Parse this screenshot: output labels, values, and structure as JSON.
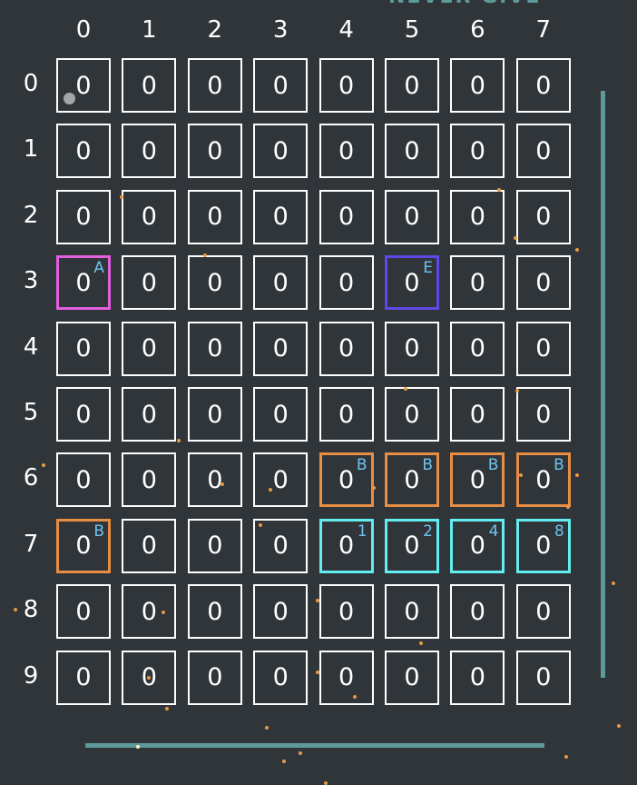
{
  "game": {
    "title": "NEVER GIVE",
    "column_labels": [
      "0",
      "1",
      "2",
      "3",
      "4",
      "5",
      "6",
      "7"
    ],
    "row_labels": [
      "0",
      "1",
      "2",
      "3",
      "4",
      "5",
      "6",
      "7",
      "8",
      "9"
    ],
    "rows": [
      [
        {
          "v": "0"
        },
        {
          "v": "0"
        },
        {
          "v": "0"
        },
        {
          "v": "0"
        },
        {
          "v": "0"
        },
        {
          "v": "0"
        },
        {
          "v": "0"
        },
        {
          "v": "0"
        }
      ],
      [
        {
          "v": "0"
        },
        {
          "v": "0"
        },
        {
          "v": "0"
        },
        {
          "v": "0"
        },
        {
          "v": "0"
        },
        {
          "v": "0"
        },
        {
          "v": "0"
        },
        {
          "v": "0"
        }
      ],
      [
        {
          "v": "0"
        },
        {
          "v": "0"
        },
        {
          "v": "0"
        },
        {
          "v": "0"
        },
        {
          "v": "0"
        },
        {
          "v": "0"
        },
        {
          "v": "0"
        },
        {
          "v": "0"
        }
      ],
      [
        {
          "v": "0",
          "tag": "A",
          "color": "#e45ee0"
        },
        {
          "v": "0"
        },
        {
          "v": "0"
        },
        {
          "v": "0"
        },
        {
          "v": "0"
        },
        {
          "v": "0",
          "tag": "E",
          "color": "#5f48e8"
        },
        {
          "v": "0"
        },
        {
          "v": "0"
        }
      ],
      [
        {
          "v": "0"
        },
        {
          "v": "0"
        },
        {
          "v": "0"
        },
        {
          "v": "0"
        },
        {
          "v": "0"
        },
        {
          "v": "0"
        },
        {
          "v": "0"
        },
        {
          "v": "0"
        }
      ],
      [
        {
          "v": "0"
        },
        {
          "v": "0"
        },
        {
          "v": "0"
        },
        {
          "v": "0"
        },
        {
          "v": "0"
        },
        {
          "v": "0"
        },
        {
          "v": "0"
        },
        {
          "v": "0"
        }
      ],
      [
        {
          "v": "0"
        },
        {
          "v": "0"
        },
        {
          "v": "0"
        },
        {
          "v": "0"
        },
        {
          "v": "0",
          "tag": "B",
          "color": "#e88e44"
        },
        {
          "v": "0",
          "tag": "B",
          "color": "#e88e44"
        },
        {
          "v": "0",
          "tag": "B",
          "color": "#e88e44"
        },
        {
          "v": "0",
          "tag": "B",
          "color": "#e88e44"
        }
      ],
      [
        {
          "v": "0",
          "tag": "B",
          "color": "#e88e44"
        },
        {
          "v": "0"
        },
        {
          "v": "0"
        },
        {
          "v": "0"
        },
        {
          "v": "0",
          "tag": "1",
          "color": "#62eef0"
        },
        {
          "v": "0",
          "tag": "2",
          "color": "#62eef0"
        },
        {
          "v": "0",
          "tag": "4",
          "color": "#62eef0"
        },
        {
          "v": "0",
          "tag": "8",
          "color": "#62eef0"
        }
      ],
      [
        {
          "v": "0"
        },
        {
          "v": "0"
        },
        {
          "v": "0"
        },
        {
          "v": "0"
        },
        {
          "v": "0"
        },
        {
          "v": "0"
        },
        {
          "v": "0"
        },
        {
          "v": "0"
        }
      ],
      [
        {
          "v": "0"
        },
        {
          "v": "0"
        },
        {
          "v": "0"
        },
        {
          "v": "0"
        },
        {
          "v": "0"
        },
        {
          "v": "0"
        },
        {
          "v": "0"
        },
        {
          "v": "0"
        }
      ]
    ]
  },
  "colors": {
    "background": "#30353a",
    "grid": "#ffffff",
    "tag_text": "#6ec3ee",
    "accent": "#5f9a9b",
    "particle": "#e59a42"
  }
}
